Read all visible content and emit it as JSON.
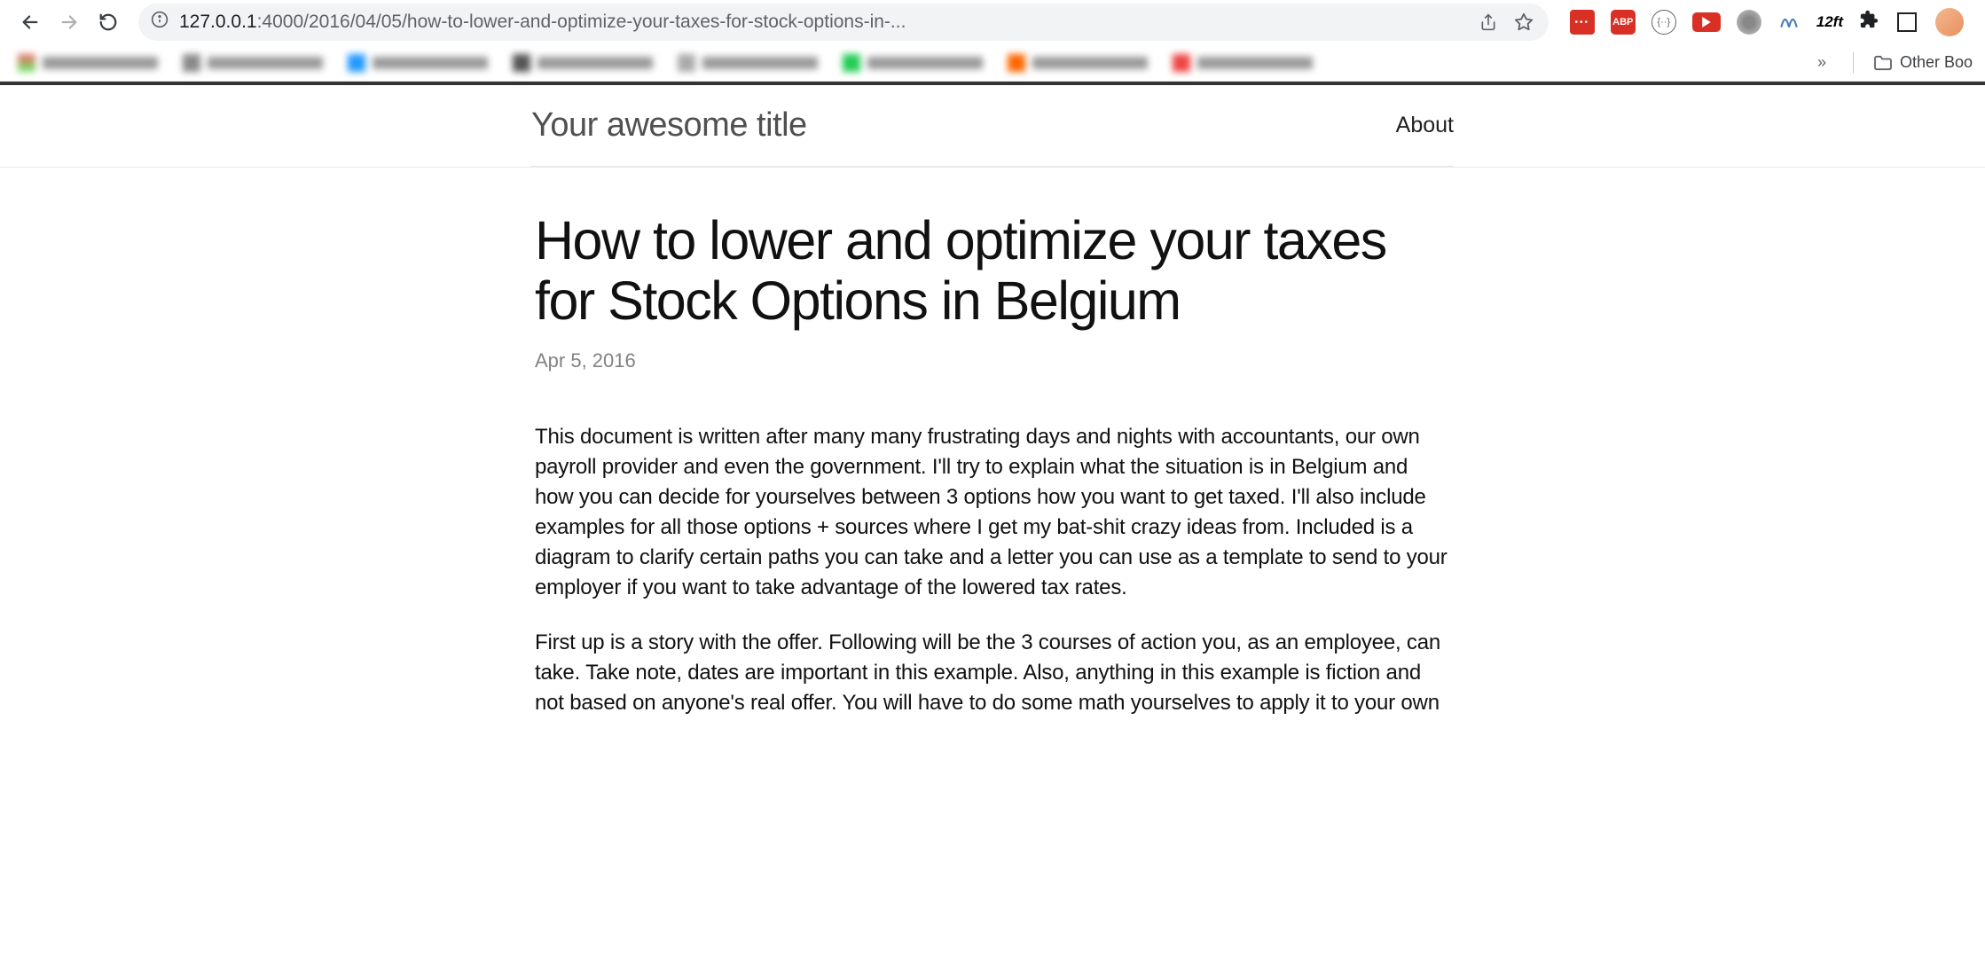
{
  "browser": {
    "url_host": "127.0.0.1",
    "url_port_path": ":4000/2016/04/05/how-to-lower-and-optimize-your-taxes-for-stock-options-in-...",
    "other_bookmarks_label": "Other Boo",
    "ext_12ft": "12ft",
    "ext_abp": "ABP",
    "ext_braces": "{··}"
  },
  "site": {
    "title": "Your awesome title",
    "nav_about": "About"
  },
  "post": {
    "title": "How to lower and optimize your taxes for Stock Options in Belgium",
    "date": "Apr 5, 2016",
    "p1": "This document is written after many many frustrating days and nights with accountants, our own payroll provider and even the government. I'll try to explain what the situation is in Belgium and how you can decide for yourselves between 3 options how you want to get taxed. I'll also include examples for all those options + sources where I get my bat-shit crazy ideas from. Included is a diagram to clarify certain paths you can take and a letter you can use as a template to send to your employer if you want to take advantage of the lowered tax rates.",
    "p2": "First up is a story with the offer. Following will be the 3 courses of action you, as an employee, can take. Take note, dates are important in this example. Also, anything in this example is fiction and not based on anyone's real offer. You will have to do some math yourselves to apply it to your own"
  }
}
